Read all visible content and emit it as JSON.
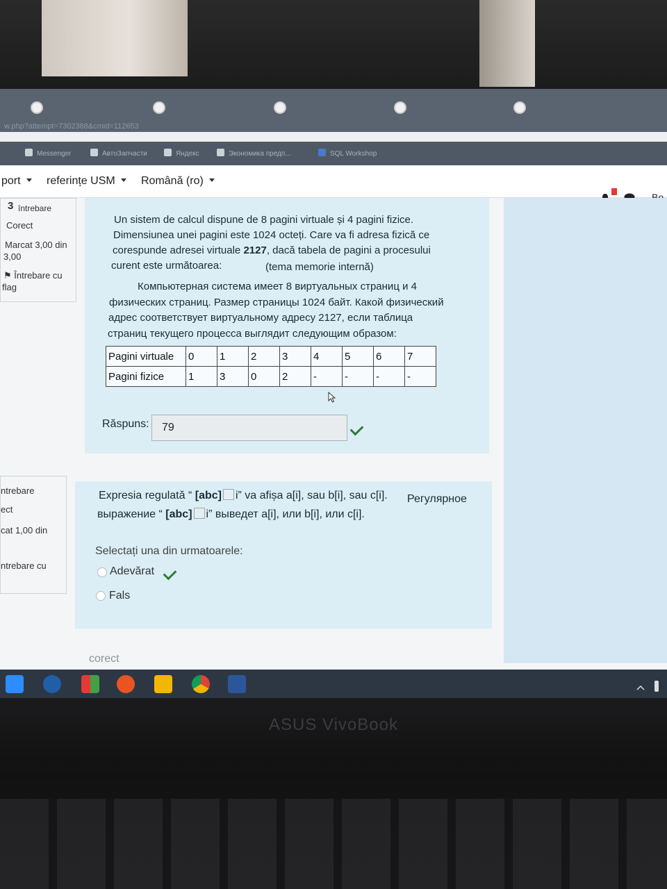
{
  "browser": {
    "url_fragment": "w.php?attempt=7302388&cmid=112653",
    "bookmarks": [
      "Messenger",
      "АвтоЗапчасти",
      "Яндекс",
      "Экономика предп...",
      "SQL Workshop"
    ]
  },
  "navbar": {
    "support": "port",
    "references": "referințe USM",
    "language": "Română (ro)",
    "user_initials": "Bo"
  },
  "question3_info": {
    "number": "3",
    "label": "întrebare",
    "status": "Corect",
    "mark_line1": "Marcat 3,00 din",
    "mark_line2": "3,00",
    "flag_line1": "Întrebare cu",
    "flag_line2": "flag"
  },
  "question3": {
    "ro_line1": "Un sistem de calcul dispune de 8 pagini virtuale și 4 pagini fizice.",
    "ro_line2": "Dimensiunea unei pagini este 1024 octeți. Care va fi adresa fizică ce",
    "ro_line3_pre": "corespunde adresei virtuale ",
    "ro_line3_bold": "2127",
    "ro_line3_post": ", dacă tabela de pagini a procesului",
    "ro_line4": "curent este următoarea:",
    "ro_note": "(tema memorie internă)",
    "ru_line1": "Компьютерная система имеет 8 виртуальных страниц и 4",
    "ru_line2": "физических страниц. Размер страницы 1024 байт. Какой физический",
    "ru_line3": "адрес соответствует виртуальному адресу 2127, если таблица",
    "ru_line4": "страниц текущего процесса выглядит следующим образом:",
    "table": {
      "row1_header": "Pagini virtuale",
      "row1": [
        "0",
        "1",
        "2",
        "3",
        "4",
        "5",
        "6",
        "7"
      ],
      "row2_header": "Pagini fizice",
      "row2": [
        "1",
        "3",
        "0",
        "2",
        "-",
        "-",
        "-",
        "-"
      ]
    },
    "answer_label": "Răspuns:",
    "answer_value": "79"
  },
  "question4_info": {
    "label": "ntrebare",
    "status": "ect",
    "mark": "cat 1,00 din",
    "flag": "ntrebare cu"
  },
  "question4": {
    "ro_pre": "Expresia regulată “ ",
    "ro_bold": "[abc]",
    "ro_post": "i” va afișa a[i], sau b[i], sau c[i].",
    "ru_inline": "Регулярное",
    "ru_pre": "выражение  “ ",
    "ru_bold": "[abc]",
    "ru_post": "i” выведет a[i], или b[i], или c[i].",
    "prompt": "Selectați una din urmatoarele:",
    "option_true": "Adevărat",
    "option_false": "Fals"
  },
  "footer": {
    "feedback": "corect"
  },
  "laptop_brand": "ASUS VivoBook",
  "colors": {
    "question_bg": "#dbeef6",
    "correct_check": "#2e7d32",
    "taskbar": "#2d3744"
  }
}
